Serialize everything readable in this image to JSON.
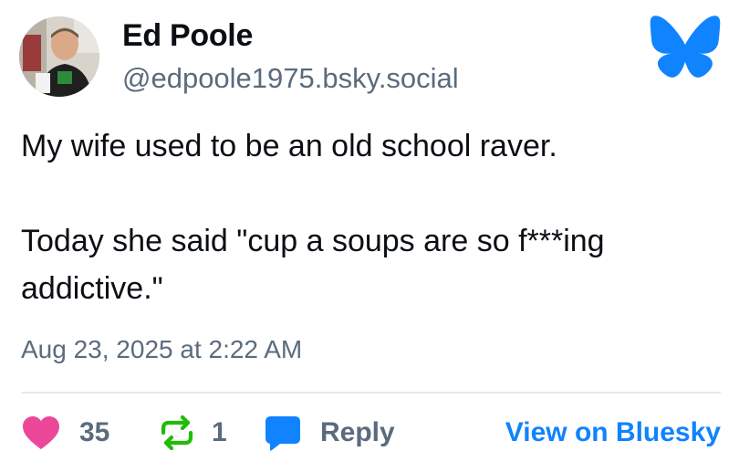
{
  "author": {
    "display_name": "Ed Poole",
    "handle": "@edpoole1975.bsky.social",
    "avatar_icon": "user-photo-avatar"
  },
  "logo_icon": "bluesky-butterfly-logo",
  "post": {
    "text": "My wife used to be an old school raver.\n\nToday she said \"cup a soups are so f***ing addictive.\"",
    "timestamp": "Aug 23, 2025 at 2:22 AM"
  },
  "actions": {
    "likes": {
      "icon": "heart-icon",
      "count": "35"
    },
    "reposts": {
      "icon": "repost-icon",
      "count": "1"
    },
    "reply": {
      "icon": "reply-bubble-icon",
      "label": "Reply"
    },
    "view": {
      "label": "View on Bluesky"
    }
  },
  "colors": {
    "brand_blue": "#1083fe",
    "like_pink": "#ec4899",
    "repost_green": "#20bc07",
    "muted_text": "#5b6b7d"
  }
}
